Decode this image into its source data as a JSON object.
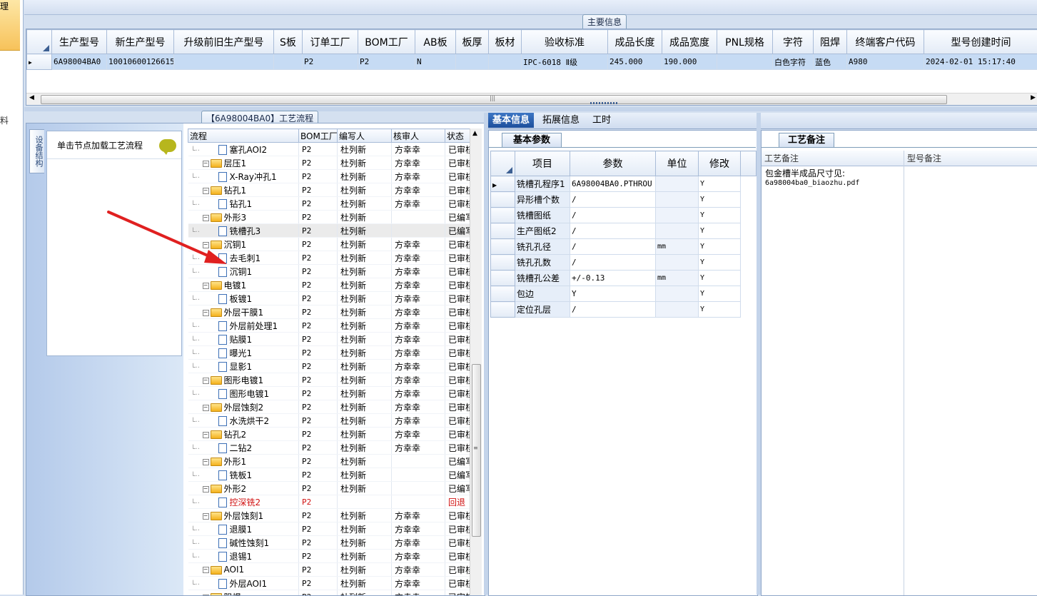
{
  "left_strip": {
    "top_tab_char": "理",
    "side_char": "料"
  },
  "main_info": {
    "group_title": "主要信息",
    "columns": [
      "生产型号",
      "新生产型号",
      "升级前旧生产型号",
      "S板",
      "订单工厂",
      "BOM工厂",
      "AB板",
      "板厚",
      "板材",
      "验收标准",
      "成品长度",
      "成品宽度",
      "PNL规格",
      "字符",
      "阻焊",
      "终端客户代码",
      "型号创建时间"
    ],
    "row": [
      "6A98004BA0",
      "10010600126615",
      "",
      "",
      "P2",
      "P2",
      "N",
      "",
      "",
      "IPC-6018 Ⅱ级",
      "245.000",
      "190.000",
      "",
      "白色字符",
      "蓝色",
      "A980",
      "2024-02-01 15:17:40"
    ]
  },
  "process": {
    "group_title": "【6A98004BA0】工艺流程",
    "vertical_tab": "设备结构",
    "note_text": "单击节点加载工艺流程",
    "columns": [
      "流程",
      "BOM工厂",
      "编写人",
      "核审人",
      "状态"
    ],
    "rows": [
      {
        "level": 2,
        "name": "塞孔AOI2",
        "bom": "P2",
        "writer": "杜列新",
        "reviewer": "方幸幸",
        "status": "已审核"
      },
      {
        "level": 1,
        "name": "层压1",
        "bom": "P2",
        "writer": "杜列新",
        "reviewer": "方幸幸",
        "status": "已审核"
      },
      {
        "level": 2,
        "name": "X-Ray冲孔1",
        "bom": "P2",
        "writer": "杜列新",
        "reviewer": "方幸幸",
        "status": "已审核"
      },
      {
        "level": 1,
        "name": "钻孔1",
        "bom": "P2",
        "writer": "杜列新",
        "reviewer": "方幸幸",
        "status": "已审核"
      },
      {
        "level": 2,
        "name": "钻孔1",
        "bom": "P2",
        "writer": "杜列新",
        "reviewer": "方幸幸",
        "status": "已审核"
      },
      {
        "level": 1,
        "name": "外形3",
        "bom": "P2",
        "writer": "杜列新",
        "reviewer": "",
        "status": "已编写"
      },
      {
        "level": 2,
        "name": "铣槽孔3",
        "bom": "P2",
        "writer": "杜列新",
        "reviewer": "",
        "status": "已编写",
        "highlight": true
      },
      {
        "level": 1,
        "name": "沉铜1",
        "bom": "P2",
        "writer": "杜列新",
        "reviewer": "方幸幸",
        "status": "已审核"
      },
      {
        "level": 2,
        "name": "去毛刺1",
        "bom": "P2",
        "writer": "杜列新",
        "reviewer": "方幸幸",
        "status": "已审核"
      },
      {
        "level": 2,
        "name": "沉铜1",
        "bom": "P2",
        "writer": "杜列新",
        "reviewer": "方幸幸",
        "status": "已审核"
      },
      {
        "level": 1,
        "name": "电镀1",
        "bom": "P2",
        "writer": "杜列新",
        "reviewer": "方幸幸",
        "status": "已审核"
      },
      {
        "level": 2,
        "name": "板镀1",
        "bom": "P2",
        "writer": "杜列新",
        "reviewer": "方幸幸",
        "status": "已审核"
      },
      {
        "level": 1,
        "name": "外层干膜1",
        "bom": "P2",
        "writer": "杜列新",
        "reviewer": "方幸幸",
        "status": "已审核"
      },
      {
        "level": 2,
        "name": "外层前处理1",
        "bom": "P2",
        "writer": "杜列新",
        "reviewer": "方幸幸",
        "status": "已审核"
      },
      {
        "level": 2,
        "name": "贴膜1",
        "bom": "P2",
        "writer": "杜列新",
        "reviewer": "方幸幸",
        "status": "已审核"
      },
      {
        "level": 2,
        "name": "曝光1",
        "bom": "P2",
        "writer": "杜列新",
        "reviewer": "方幸幸",
        "status": "已审核"
      },
      {
        "level": 2,
        "name": "显影1",
        "bom": "P2",
        "writer": "杜列新",
        "reviewer": "方幸幸",
        "status": "已审核"
      },
      {
        "level": 1,
        "name": "图形电镀1",
        "bom": "P2",
        "writer": "杜列新",
        "reviewer": "方幸幸",
        "status": "已审核"
      },
      {
        "level": 2,
        "name": "图形电镀1",
        "bom": "P2",
        "writer": "杜列新",
        "reviewer": "方幸幸",
        "status": "已审核"
      },
      {
        "level": 1,
        "name": "外层蚀刻2",
        "bom": "P2",
        "writer": "杜列新",
        "reviewer": "方幸幸",
        "status": "已审核"
      },
      {
        "level": 2,
        "name": "水洗烘干2",
        "bom": "P2",
        "writer": "杜列新",
        "reviewer": "方幸幸",
        "status": "已审核"
      },
      {
        "level": 1,
        "name": "钻孔2",
        "bom": "P2",
        "writer": "杜列新",
        "reviewer": "方幸幸",
        "status": "已审核"
      },
      {
        "level": 2,
        "name": "二钻2",
        "bom": "P2",
        "writer": "杜列新",
        "reviewer": "方幸幸",
        "status": "已审核"
      },
      {
        "level": 1,
        "name": "外形1",
        "bom": "P2",
        "writer": "杜列新",
        "reviewer": "",
        "status": "已编写"
      },
      {
        "level": 2,
        "name": "铣板1",
        "bom": "P2",
        "writer": "杜列新",
        "reviewer": "",
        "status": "已编写"
      },
      {
        "level": 1,
        "name": "外形2",
        "bom": "P2",
        "writer": "杜列新",
        "reviewer": "",
        "status": "已编写"
      },
      {
        "level": 2,
        "name": "控深铣2",
        "bom": "P2",
        "writer": "",
        "reviewer": "",
        "status": "回退",
        "red": true
      },
      {
        "level": 1,
        "name": "外层蚀刻1",
        "bom": "P2",
        "writer": "杜列新",
        "reviewer": "方幸幸",
        "status": "已审核"
      },
      {
        "level": 2,
        "name": "退膜1",
        "bom": "P2",
        "writer": "杜列新",
        "reviewer": "方幸幸",
        "status": "已审核"
      },
      {
        "level": 2,
        "name": "碱性蚀刻1",
        "bom": "P2",
        "writer": "杜列新",
        "reviewer": "方幸幸",
        "status": "已审核"
      },
      {
        "level": 2,
        "name": "退锡1",
        "bom": "P2",
        "writer": "杜列新",
        "reviewer": "方幸幸",
        "status": "已审核"
      },
      {
        "level": 1,
        "name": "AOI1",
        "bom": "P2",
        "writer": "杜列新",
        "reviewer": "方幸幸",
        "status": "已审核"
      },
      {
        "level": 2,
        "name": "外层AOI1",
        "bom": "P2",
        "writer": "杜列新",
        "reviewer": "方幸幸",
        "status": "已审核"
      },
      {
        "level": 1,
        "name": "阻焊",
        "bom": "P2",
        "writer": "杜列新",
        "reviewer": "方幸幸",
        "status": "已审核"
      }
    ]
  },
  "tabs": [
    "基本信息",
    "拓展信息",
    "工时"
  ],
  "params": {
    "subtab": "基本参数",
    "columns": [
      "项目",
      "参数",
      "单位",
      "修改"
    ],
    "rows": [
      {
        "item": "铣槽孔程序1",
        "value": "6A98004BA0.PTHROU",
        "unit": "",
        "mod": "Y"
      },
      {
        "item": "异形槽个数",
        "value": "/",
        "unit": "",
        "mod": "Y"
      },
      {
        "item": "铣槽图纸",
        "value": "/",
        "unit": "",
        "mod": "Y"
      },
      {
        "item": "生产图纸2",
        "value": "/",
        "unit": "",
        "mod": "Y"
      },
      {
        "item": "铣孔孔径",
        "value": "/",
        "unit": "mm",
        "mod": "Y"
      },
      {
        "item": "铣孔孔数",
        "value": "/",
        "unit": "",
        "mod": "Y"
      },
      {
        "item": "铣槽孔公差",
        "value": "+/-0.13",
        "unit": "mm",
        "mod": "Y"
      },
      {
        "item": "包边",
        "value": "Y",
        "unit": "",
        "mod": "Y"
      },
      {
        "item": "定位孔层",
        "value": "/",
        "unit": "",
        "mod": "Y"
      }
    ]
  },
  "remarks": {
    "subtab": "工艺备注",
    "col1": "工艺备注",
    "col2": "型号备注",
    "text_line1": "包金槽半成品尺寸见:",
    "text_line2": "6a98004ba0_biaozhu.pdf"
  },
  "colors": {
    "accent": "#1d4f9c",
    "arrow": "#e02020",
    "folder": "#f4b21c",
    "note_bubble": "#b7b61d"
  }
}
